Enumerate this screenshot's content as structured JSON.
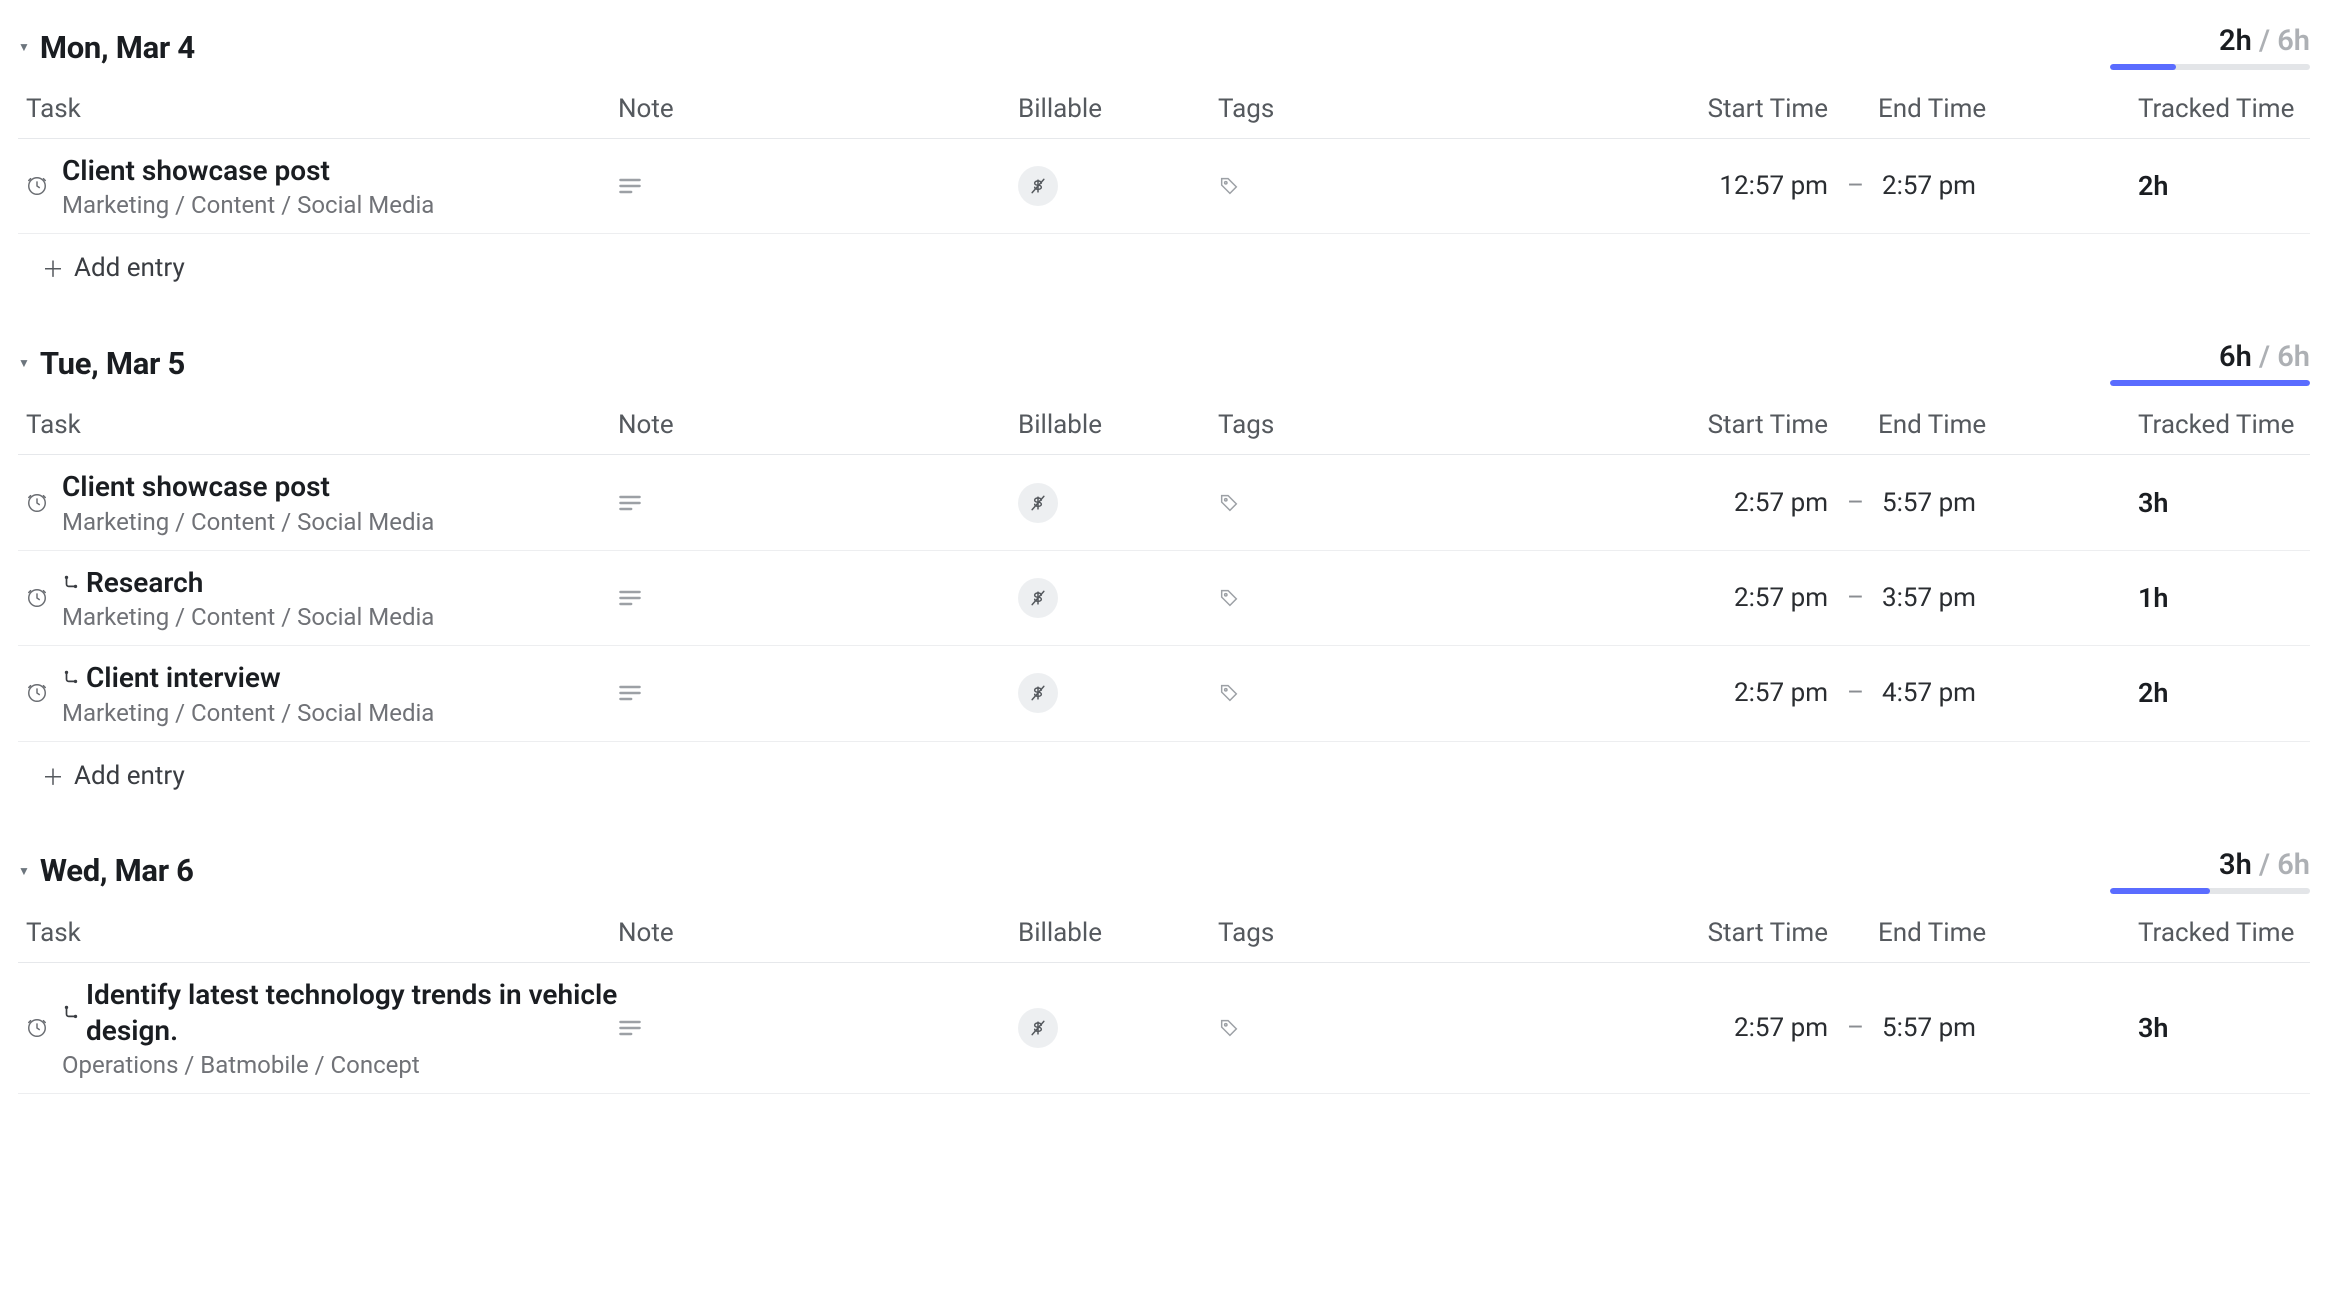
{
  "columns": {
    "task": "Task",
    "note": "Note",
    "billable": "Billable",
    "tags": "Tags",
    "start": "Start Time",
    "end": "End Time",
    "tracked": "Tracked Time"
  },
  "add_entry_label": "Add entry",
  "days": [
    {
      "title": "Mon, Mar 4",
      "tracked": "2h",
      "total": "6h",
      "progress_pct": 33,
      "entries": [
        {
          "task_name": "Client showcase post",
          "task_path": "Marketing / Content / Social Media",
          "is_subtask": false,
          "start": "12:57 pm",
          "end": "2:57 pm",
          "tracked": "2h"
        }
      ]
    },
    {
      "title": "Tue, Mar 5",
      "tracked": "6h",
      "total": "6h",
      "progress_pct": 100,
      "entries": [
        {
          "task_name": "Client showcase post",
          "task_path": "Marketing / Content / Social Media",
          "is_subtask": false,
          "start": "2:57 pm",
          "end": "5:57 pm",
          "tracked": "3h"
        },
        {
          "task_name": "Research",
          "task_path": "Marketing / Content / Social Media",
          "is_subtask": true,
          "start": "2:57 pm",
          "end": "3:57 pm",
          "tracked": "1h"
        },
        {
          "task_name": "Client interview",
          "task_path": "Marketing / Content / Social Media",
          "is_subtask": true,
          "start": "2:57 pm",
          "end": "4:57 pm",
          "tracked": "2h"
        }
      ]
    },
    {
      "title": "Wed, Mar 6",
      "tracked": "3h",
      "total": "6h",
      "progress_pct": 50,
      "entries": [
        {
          "task_name": "Identify latest technology trends in vehicle design.",
          "task_path": "Operations / Batmobile / Concept",
          "is_subtask": true,
          "start": "2:57 pm",
          "end": "5:57 pm",
          "tracked": "3h"
        }
      ]
    }
  ]
}
